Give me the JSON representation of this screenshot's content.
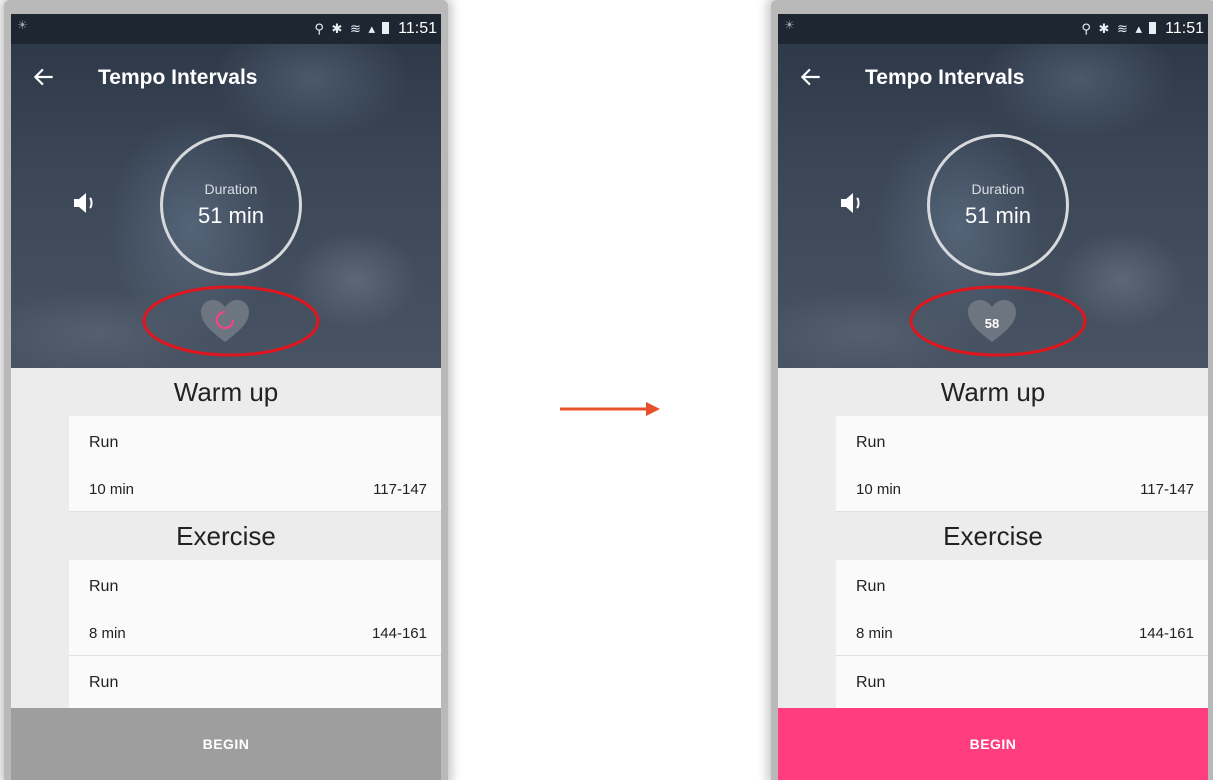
{
  "status_bar": {
    "time": "11:51"
  },
  "arrow_color": "#e8502a",
  "screens": [
    {
      "state": "before",
      "app_bar": {
        "title": "Tempo Intervals"
      },
      "duration": {
        "label": "Duration",
        "value": "51 min"
      },
      "heart_rate": {
        "value": "",
        "loading": true,
        "icon": "heart-icon",
        "spinner_color": "#ff4081"
      },
      "highlight_color": "#e0161e",
      "sections": [
        {
          "title": "Warm up",
          "rows": [
            {
              "name": "Run",
              "duration": "10 min",
              "zone": "117-147"
            }
          ]
        },
        {
          "title": "Exercise",
          "rows": [
            {
              "name": "Run",
              "duration": "8 min",
              "zone": "144-161"
            },
            {
              "name": "Run",
              "duration": "",
              "zone": ""
            }
          ]
        }
      ],
      "begin": {
        "label": "BEGIN",
        "enabled": false,
        "color": "#9e9e9e"
      }
    },
    {
      "state": "after",
      "app_bar": {
        "title": "Tempo Intervals"
      },
      "duration": {
        "label": "Duration",
        "value": "51 min"
      },
      "heart_rate": {
        "value": "58",
        "loading": false,
        "icon": "heart-icon"
      },
      "highlight_color": "#e0161e",
      "sections": [
        {
          "title": "Warm up",
          "rows": [
            {
              "name": "Run",
              "duration": "10 min",
              "zone": "117-147"
            }
          ]
        },
        {
          "title": "Exercise",
          "rows": [
            {
              "name": "Run",
              "duration": "8 min",
              "zone": "144-161"
            },
            {
              "name": "Run",
              "duration": "",
              "zone": ""
            }
          ]
        }
      ],
      "begin": {
        "label": "BEGIN",
        "enabled": true,
        "color": "#ff3d7f"
      }
    }
  ]
}
